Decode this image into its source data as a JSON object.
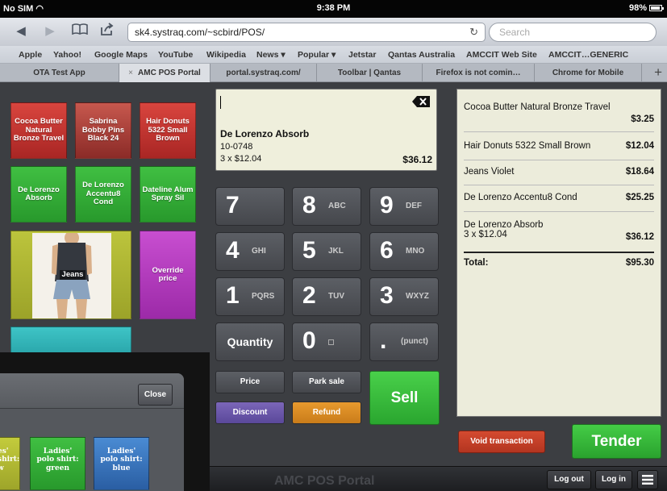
{
  "status": {
    "carrier": "No SIM",
    "time": "9:38 PM",
    "battery": "98%"
  },
  "browser": {
    "url": "sk4.systraq.com/~scbird/POS/",
    "search_placeholder": "Search",
    "bookmarks": [
      "Apple",
      "Yahoo!",
      "Google Maps",
      "YouTube",
      "Wikipedia",
      "News ▾",
      "Popular ▾",
      "Jetstar",
      "Qantas Australia",
      "AMCCIT Web Site",
      "AMCCIT…GENERIC"
    ],
    "tabs": [
      "OTA Test App",
      "AMC POS Portal",
      "portal.systraq.com/",
      "Toolbar | Qantas",
      "Firefox is not comin…",
      "Chrome for Mobile"
    ],
    "tab_close": "×",
    "new_tab": "+"
  },
  "products": [
    {
      "label": "Cocoa Butter Natural Bronze Travel",
      "color": "#c4302c"
    },
    {
      "label": "Sabrina Bobby Pins Black 24",
      "color": "#b8342f"
    },
    {
      "label": "Hair Donuts 5322 Small Brown",
      "color": "#c4302c"
    },
    {
      "label": "De Lorenzo Absorb",
      "color": "#33ae37"
    },
    {
      "label": "De Lorenzo Accentu8 Cond",
      "color": "#33ae37"
    },
    {
      "label": "Dateline Alum Spray Sil",
      "color": "#33ae37"
    },
    {
      "label": "Jeans",
      "color": "#b5bd35"
    },
    {
      "label": "Override price",
      "color": "#b63bbf"
    },
    {
      "label": "",
      "color": "#33b5b8"
    }
  ],
  "display": {
    "name": "De Lorenzo Absorb",
    "code": "10-0748",
    "qty": "3 x $12.04",
    "total": "$36.12"
  },
  "keypad": {
    "keys": [
      {
        "digit": "7",
        "sub": ""
      },
      {
        "digit": "8",
        "sub": "ABC"
      },
      {
        "digit": "9",
        "sub": "DEF"
      },
      {
        "digit": "4",
        "sub": "GHI"
      },
      {
        "digit": "5",
        "sub": "JKL"
      },
      {
        "digit": "6",
        "sub": "MNO"
      },
      {
        "digit": "1",
        "sub": "PQRS"
      },
      {
        "digit": "2",
        "sub": "TUV"
      },
      {
        "digit": "3",
        "sub": "WXYZ"
      }
    ],
    "quantity": "Quantity",
    "zero": "0",
    "dot": ".",
    "punct": "(punct)",
    "price": "Price",
    "park_sale": "Park sale",
    "discount": "Discount",
    "refund": "Refund",
    "sell": "Sell"
  },
  "receipt": {
    "items": [
      {
        "name": "Cocoa Butter Natural Bronze Travel",
        "sub": "",
        "price": "$3.25"
      },
      {
        "name": "Hair Donuts 5322 Small Brown",
        "sub": "",
        "price": "$12.04"
      },
      {
        "name": "Jeans Violet",
        "sub": "",
        "price": "$18.64"
      },
      {
        "name": "De Lorenzo Accentu8 Cond",
        "sub": "",
        "price": "$25.25"
      },
      {
        "name": "De Lorenzo Absorb",
        "sub": "3 x $12.04",
        "price": "$36.12"
      }
    ],
    "total_label": "Total:",
    "total": "$95.30"
  },
  "actions": {
    "void": "Void transaction",
    "tender": "Tender"
  },
  "bottom": {
    "brand": "AMC POS Portal",
    "logout": "Log out",
    "login": "Log in"
  },
  "popup": {
    "close": "Close",
    "tiles": [
      {
        "label": "Ladies' polo shirt: yellow",
        "visible": "es'\nshirt:\nw",
        "color": "#b5bd35"
      },
      {
        "label": "Ladies' polo shirt: green",
        "visible": "Ladies'\npolo shirt:\ngreen",
        "color": "#33ae37"
      },
      {
        "label": "Ladies' polo shirt: blue",
        "visible": "Ladies'\npolo shirt:\nblue",
        "color": "#3f7fc7"
      }
    ]
  }
}
